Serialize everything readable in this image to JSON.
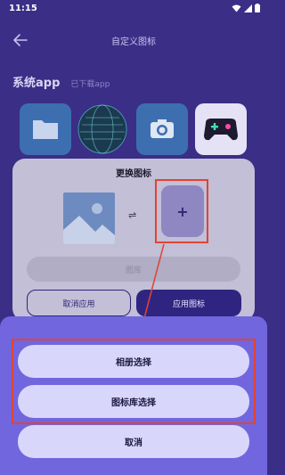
{
  "status_bar": {
    "time": "11:15"
  },
  "app_bar": {
    "title": "自定义图标"
  },
  "section": {
    "title": "系统app",
    "subtitle": "已下载app"
  },
  "app_icons": [
    "folder-icon",
    "globe-icon",
    "camera-icon",
    "gamepad-icon"
  ],
  "change_dialog": {
    "title": "更换图标",
    "add_symbol": "+",
    "library_label": "图库",
    "cancel_apply_label": "取消应用",
    "apply_label": "应用图标"
  },
  "sheet": {
    "album_label": "相册选择",
    "library_label": "图标库选择",
    "cancel_label": "取消"
  },
  "colors": {
    "background": "#3a2e86",
    "sheet": "#7166de",
    "sheet_button": "#d9d6fb",
    "highlight": "#e24332"
  }
}
